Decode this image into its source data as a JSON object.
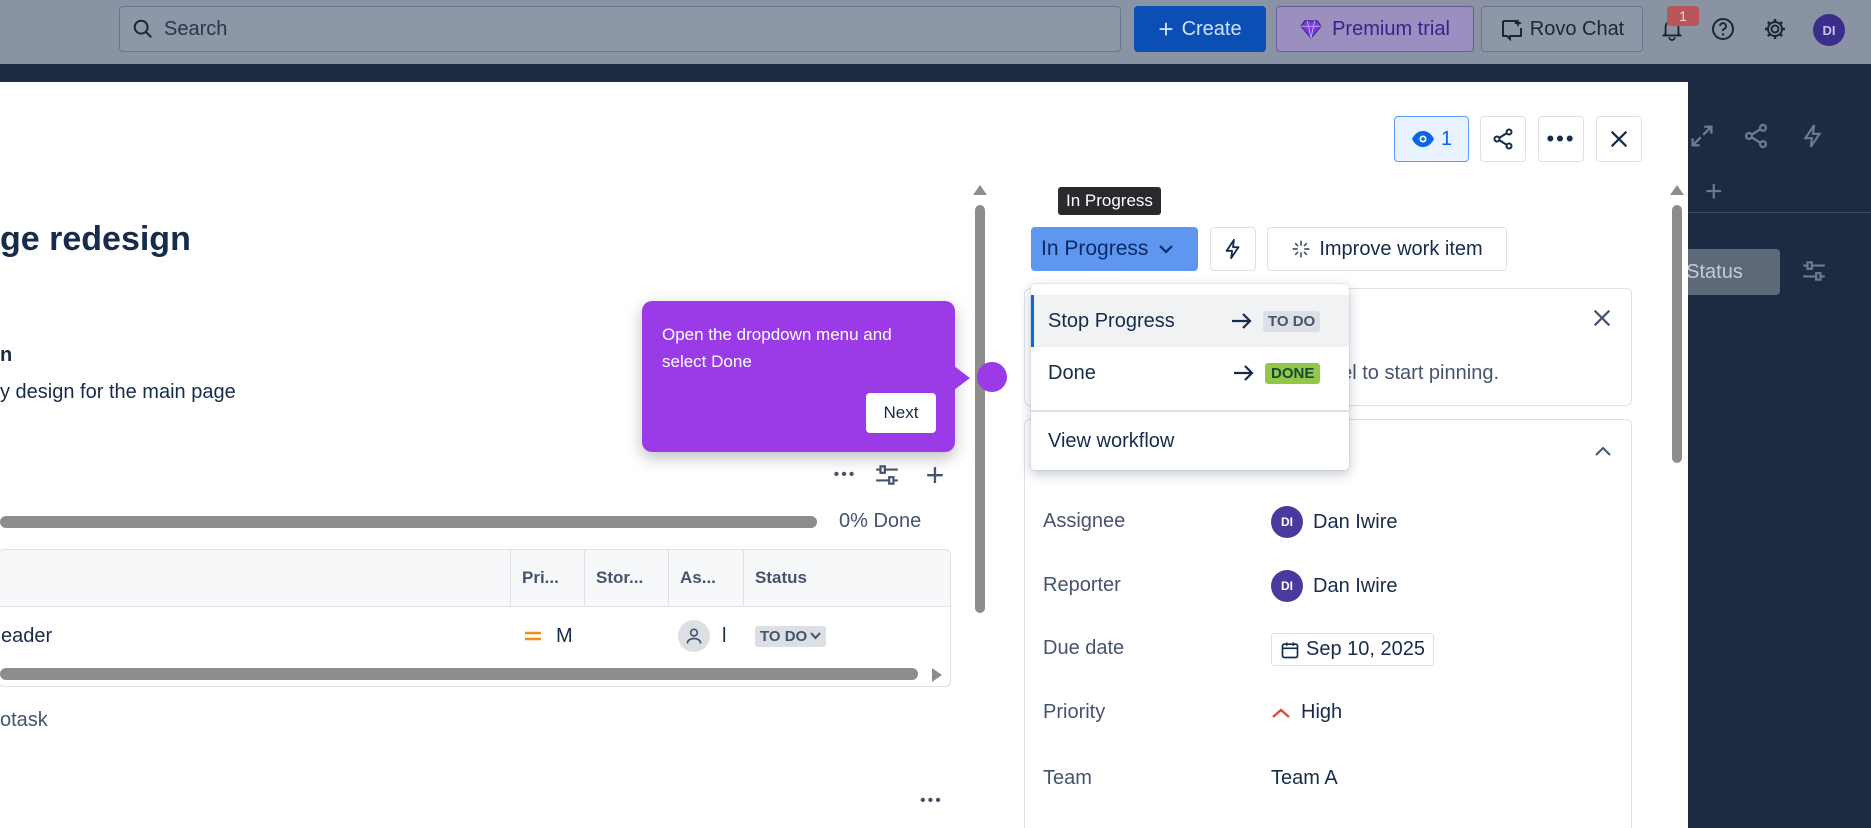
{
  "topnav": {
    "search_placeholder": "Search",
    "create_label": "Create",
    "premium_label": "Premium trial",
    "rovo_label": "Rovo Chat",
    "notification_count": "1",
    "avatar_initials": "DI"
  },
  "background": {
    "status_chip": ": Status"
  },
  "modal": {
    "watch_count": "1",
    "title": "ge redesign",
    "subheading": "n",
    "description": "y design for the main page",
    "progress_text": "0% Done",
    "progress_fraction": 0,
    "table": {
      "headers": [
        "Pri...",
        "Stor...",
        "As...",
        "Status"
      ],
      "row": {
        "summary": "eader",
        "priority": "M",
        "assignee": "l",
        "status": "TO DO"
      }
    },
    "subtask_label": "otask"
  },
  "status_panel": {
    "tooltip": "In Progress",
    "status_button": "In Progress",
    "improve_button": "Improve work item",
    "pin_text": "bel to start pinning.",
    "dropdown": {
      "items": [
        {
          "label": "Stop Progress",
          "target": "TO DO"
        },
        {
          "label": "Done",
          "target": "DONE"
        }
      ],
      "view_workflow": "View workflow"
    }
  },
  "onboarding": {
    "text": "Open the dropdown menu and select Done",
    "next_label": "Next"
  },
  "details": {
    "fields": [
      {
        "label": "Assignee",
        "value": "Dan Iwire",
        "initials": "DI"
      },
      {
        "label": "Reporter",
        "value": "Dan Iwire",
        "initials": "DI"
      },
      {
        "label": "Due date",
        "value": "Sep 10, 2025"
      },
      {
        "label": "Priority",
        "value": "High"
      },
      {
        "label": "Team",
        "value": "Team A"
      }
    ]
  },
  "colors": {
    "primary": "#0c66e4",
    "onboarding": "#9b3be8",
    "done_lozenge": "#94c748",
    "priority_high": "#e2483d",
    "priority_medium": "#f18d13"
  }
}
